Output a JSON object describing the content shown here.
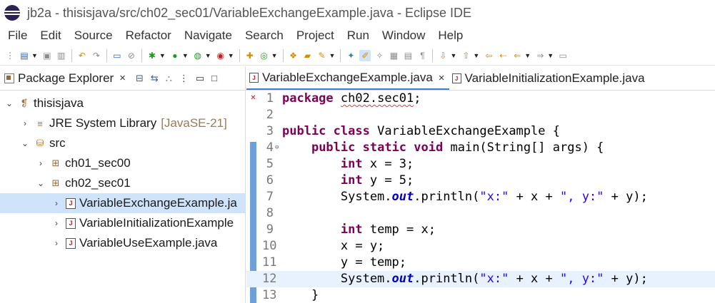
{
  "window": {
    "title": "jb2a - thisisjava/src/ch02_sec01/VariableExchangeExample.java - Eclipse IDE"
  },
  "menu": [
    "File",
    "Edit",
    "Source",
    "Refactor",
    "Navigate",
    "Search",
    "Project",
    "Run",
    "Window",
    "Help"
  ],
  "package_explorer": {
    "tab_label": "Package Explorer",
    "close_glyph": "×",
    "tree": [
      {
        "twisty": "⌄",
        "icon": "project-icon",
        "label": "thisisjava",
        "suffix": ""
      },
      {
        "twisty": "›",
        "icon": "library-icon",
        "label": "JRE System Library",
        "suffix": "[JavaSE-21]"
      },
      {
        "twisty": "⌄",
        "icon": "source-folder-icon",
        "label": "src",
        "suffix": ""
      },
      {
        "twisty": "›",
        "icon": "package-icon",
        "label": "ch01_sec00",
        "suffix": ""
      },
      {
        "twisty": "⌄",
        "icon": "package-icon",
        "label": "ch02_sec01",
        "suffix": ""
      },
      {
        "twisty": "›",
        "icon": "java-file-icon",
        "label": "VariableExchangeExample.ja",
        "suffix": ""
      },
      {
        "twisty": "›",
        "icon": "java-file-icon",
        "label": "VariableInitializationExample",
        "suffix": ""
      },
      {
        "twisty": "›",
        "icon": "java-file-icon",
        "label": "VariableUseExample.java",
        "suffix": ""
      }
    ]
  },
  "editor": {
    "tabs": [
      {
        "label": "VariableExchangeExample.java",
        "active": true,
        "close_glyph": "×"
      },
      {
        "label": "VariableInitializationExample.java",
        "active": false,
        "close_glyph": ""
      }
    ],
    "lines": [
      {
        "n": "1",
        "text": "package ch02.sec01;"
      },
      {
        "n": "2",
        "text": ""
      },
      {
        "n": "3",
        "text": "public class VariableExchangeExample {"
      },
      {
        "n": "4",
        "text": "    public static void main(String[] args) {"
      },
      {
        "n": "5",
        "text": "        int x = 3;"
      },
      {
        "n": "6",
        "text": "        int y = 5;"
      },
      {
        "n": "7",
        "text": "        System.out.println(\"x:\" + x + \", y:\" + y);"
      },
      {
        "n": "8",
        "text": ""
      },
      {
        "n": "9",
        "text": "        int temp = x;"
      },
      {
        "n": "10",
        "text": "        x = y;"
      },
      {
        "n": "11",
        "text": "        y = temp;"
      },
      {
        "n": "12",
        "text": "        System.out.println(\"x:\" + x + \", y:\" + y);"
      },
      {
        "n": "13",
        "text": "    }"
      }
    ]
  }
}
